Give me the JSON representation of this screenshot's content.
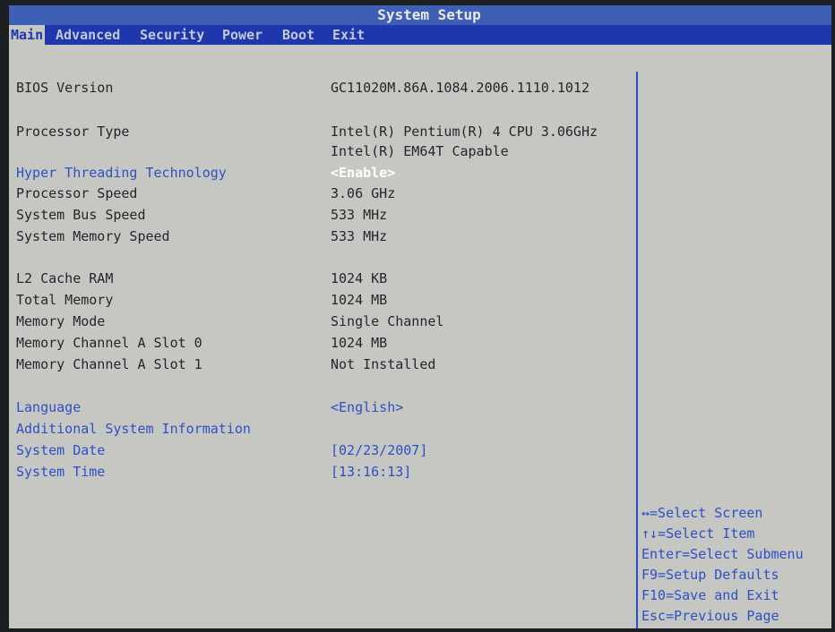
{
  "title": "System Setup",
  "menu": [
    {
      "label": "Main",
      "active": true
    },
    {
      "label": "Advanced",
      "active": false
    },
    {
      "label": "Security",
      "active": false
    },
    {
      "label": "Power",
      "active": false
    },
    {
      "label": "Boot",
      "active": false
    },
    {
      "label": "Exit",
      "active": false
    }
  ],
  "info": {
    "bios_version": {
      "label": "BIOS Version",
      "value": "GC11020M.86A.1084.2006.1110.1012"
    },
    "processor_type": {
      "label": "Processor Type",
      "value": "Intel(R) Pentium(R) 4 CPU 3.06GHz",
      "value2": "Intel(R) EM64T Capable"
    },
    "hyper_threading": {
      "label": "Hyper Threading Technology",
      "value": "<Enable>"
    },
    "processor_speed": {
      "label": "Processor Speed",
      "value": "3.06 GHz"
    },
    "system_bus_speed": {
      "label": "System Bus Speed",
      "value": "533 MHz"
    },
    "system_memory_speed": {
      "label": "System Memory Speed",
      "value": "533 MHz"
    },
    "l2_cache": {
      "label": "L2 Cache RAM",
      "value": "1024 KB"
    },
    "total_memory": {
      "label": "Total Memory",
      "value": "1024 MB"
    },
    "memory_mode": {
      "label": "Memory Mode",
      "value": "Single Channel"
    },
    "slot0": {
      "label": "Memory Channel A Slot 0",
      "value": "1024 MB"
    },
    "slot1": {
      "label": "Memory Channel A Slot 1",
      "value": "Not Installed"
    },
    "language": {
      "label": "Language",
      "value": "<English>"
    },
    "additional_info": {
      "label": "Additional System Information"
    },
    "system_date": {
      "label": "System Date",
      "value": "[02/23/2007]"
    },
    "system_time": {
      "label": "System Time",
      "value": "[13:16:13]"
    }
  },
  "help": [
    "↔=Select Screen",
    "↑↓=Select Item",
    "Enter=Select Submenu",
    "F9=Setup Defaults",
    "F10=Save and Exit",
    "Esc=Previous Page"
  ],
  "colors": {
    "screen_bg": "#c6c7c3",
    "title_bar": "#3f5fb4",
    "menu_bar": "#1e37ad",
    "selectable_text": "#2d50c4",
    "static_text": "#23272c",
    "highlight_text": "#ffffff"
  }
}
